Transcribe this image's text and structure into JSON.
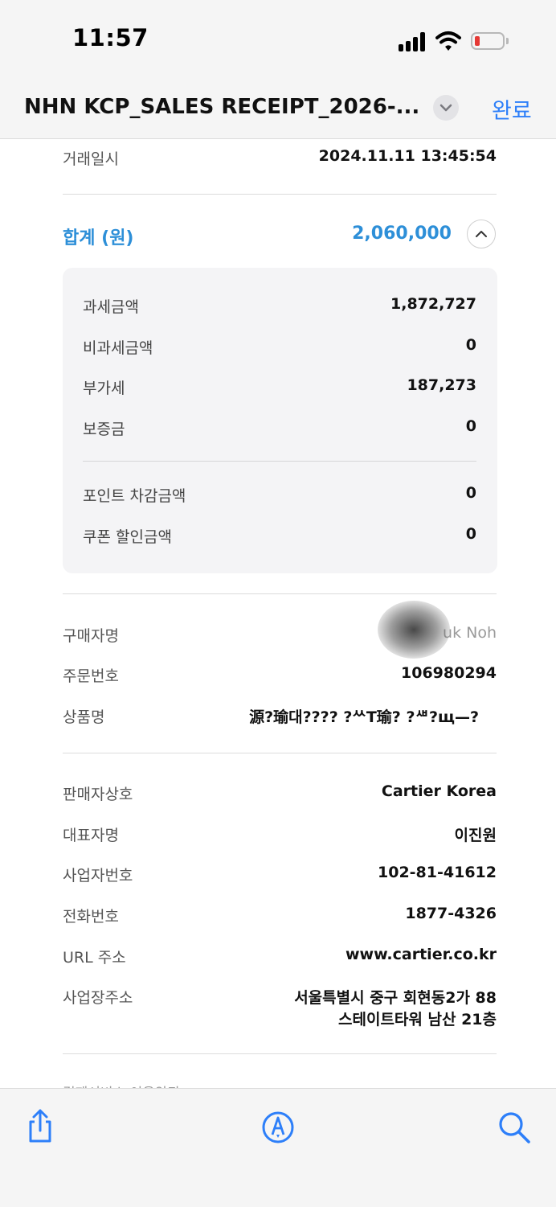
{
  "status_bar": {
    "time": "11:57"
  },
  "nav": {
    "title": "NHN KCP_SALES RECEIPT_2026-...",
    "done_label": "완료"
  },
  "receipt": {
    "transaction": {
      "label": "거래일시",
      "value": "2024.11.11 13:45:54"
    },
    "total": {
      "label": "합계 (원)",
      "value": "2,060,000"
    },
    "breakdown": [
      {
        "label": "과세금액",
        "value": "1,872,727"
      },
      {
        "label": "비과세금액",
        "value": "0"
      },
      {
        "label": "부가세",
        "value": "187,273"
      },
      {
        "label": "보증금",
        "value": "0"
      },
      {
        "label": "포인트 차감금액",
        "value": "0"
      },
      {
        "label": "쿠폰 할인금액",
        "value": "0"
      }
    ],
    "buyer": [
      {
        "label": "구매자명",
        "value": "uk Noh"
      },
      {
        "label": "주문번호",
        "value": "106980294"
      },
      {
        "label": "상품명",
        "value": "源?瑜대???? ?ᄊT瑜? ?ᄲ?щ—?"
      }
    ],
    "seller": [
      {
        "label": "판매자상호",
        "value": "Cartier Korea"
      },
      {
        "label": "대표자명",
        "value": "이진원"
      },
      {
        "label": "사업자번호",
        "value": "102-81-41612"
      },
      {
        "label": "전화번호",
        "value": "1877-4326"
      },
      {
        "label": "URL 주소",
        "value": "www.cartier.co.kr"
      },
      {
        "label": "사업장주소",
        "value_line1": "서울특별시 중구 회현동2가 88",
        "value_line2": "스테이트타워 남산 21층"
      }
    ],
    "next_section_partial": "결제서비스 이용약관"
  },
  "toolbar": {
    "share": "share-icon",
    "markup": "markup-icon",
    "search": "search-icon"
  },
  "colors": {
    "accent": "#2d7ff9",
    "total_blue": "#2d8fd8",
    "battery_low": "#e53935"
  }
}
